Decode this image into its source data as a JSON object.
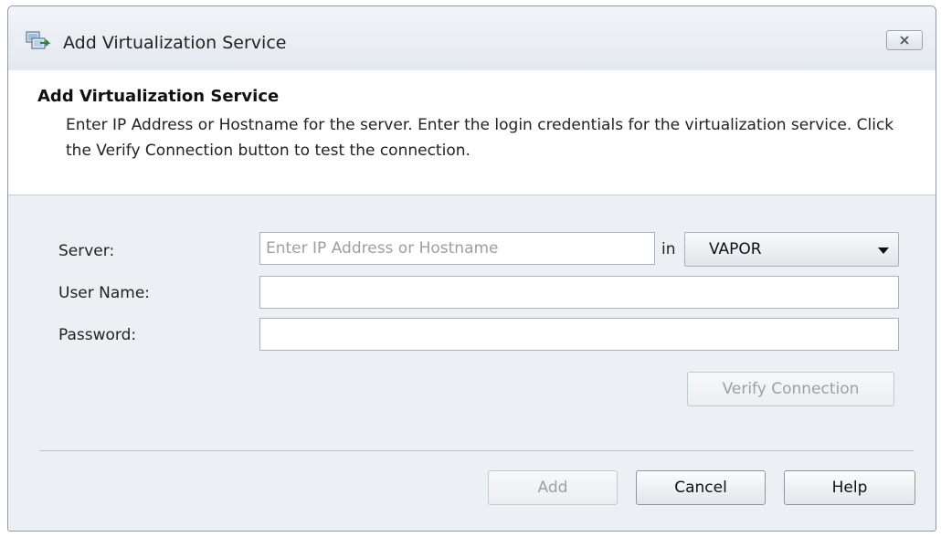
{
  "window": {
    "title": "Add Virtualization Service",
    "close_label": "✕"
  },
  "header": {
    "title": "Add Virtualization Service",
    "description": "Enter IP Address or Hostname for the server. Enter the login credentials for the virtualization service. Click the Verify Connection button to test the connection."
  },
  "form": {
    "server_label": "Server:",
    "server_value": "",
    "server_placeholder": "Enter IP Address or Hostname",
    "in_label": "in",
    "domain_selected": "VAPOR",
    "username_label": "User Name:",
    "username_value": "",
    "password_label": "Password:",
    "password_value": ""
  },
  "buttons": {
    "verify": "Verify Connection",
    "add": "Add",
    "cancel": "Cancel",
    "help": "Help"
  }
}
